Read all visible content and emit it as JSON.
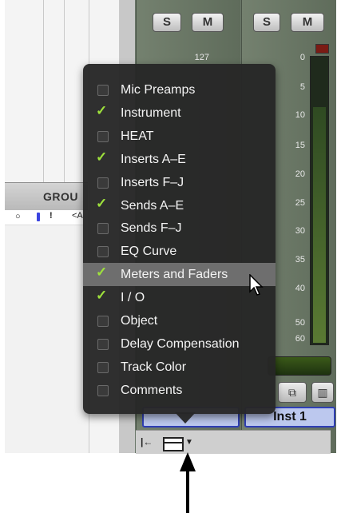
{
  "groups": {
    "header": "GROU",
    "row": {
      "circle": "○",
      "bang": "!",
      "tag": "<A"
    }
  },
  "strips": [
    {
      "solo": "S",
      "mute": "M",
      "top_value": "127",
      "name": ""
    },
    {
      "solo": "S",
      "mute": "M",
      "top_value": "",
      "name": "Inst 1"
    }
  ],
  "meter_scale": [
    "0",
    "5",
    "10",
    "15",
    "20",
    "25",
    "30",
    "35",
    "40",
    "50",
    "60"
  ],
  "menu": {
    "items": [
      {
        "label": "Mic Preamps",
        "checked": false
      },
      {
        "label": "Instrument",
        "checked": true
      },
      {
        "label": "HEAT",
        "checked": false
      },
      {
        "label": "Inserts A–E",
        "checked": true
      },
      {
        "label": "Inserts F–J",
        "checked": false
      },
      {
        "label": "Sends A–E",
        "checked": true
      },
      {
        "label": "Sends F–J",
        "checked": false
      },
      {
        "label": "EQ Curve",
        "checked": false
      },
      {
        "label": "Meters and Faders",
        "checked": true,
        "highlighted": true
      },
      {
        "label": "I / O",
        "checked": true
      },
      {
        "label": "Object",
        "checked": false
      },
      {
        "label": "Delay Compensation",
        "checked": false
      },
      {
        "label": "Track Color",
        "checked": false
      },
      {
        "label": "Comments",
        "checked": false
      }
    ]
  },
  "colors": {
    "check": "#9ee13c",
    "menu_bg": "#262626",
    "highlight": "#6e6e6e",
    "name_box": "#bcc8ee"
  }
}
